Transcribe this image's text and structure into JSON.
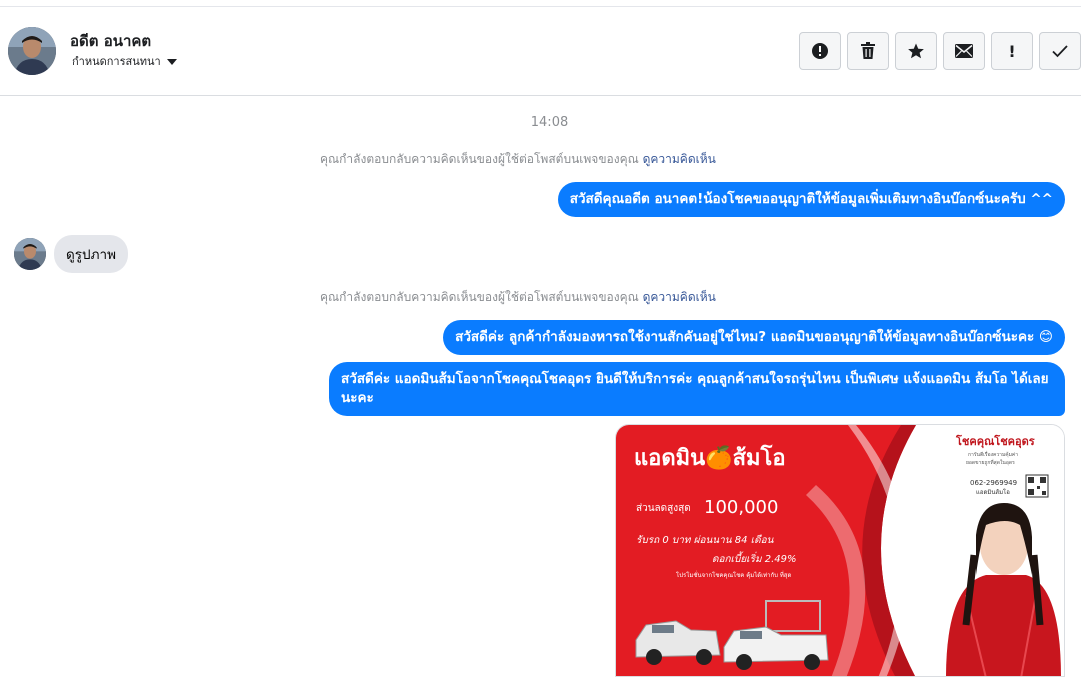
{
  "header": {
    "name": "อดีต อนาคต",
    "subtitle": "กำหนดการสนทนา",
    "actions": [
      {
        "icon": "alert-circle-icon",
        "glyph": "!"
      },
      {
        "icon": "trash-icon",
        "glyph": ""
      },
      {
        "icon": "star-icon",
        "glyph": "★"
      },
      {
        "icon": "envelope-icon",
        "glyph": "✉"
      },
      {
        "icon": "exclamation-icon",
        "glyph": "!"
      },
      {
        "icon": "checkmark-icon",
        "glyph": "✓"
      }
    ]
  },
  "conversation": {
    "timestamp": "14:08",
    "notes": [
      {
        "text": "คุณกำลังตอบกลับความคิดเห็นของผู้ใช้ต่อโพสต์บนเพจของคุณ",
        "link": "ดูความคิดเห็น"
      },
      {
        "text": "คุณกำลังตอบกลับความคิดเห็นของผู้ใช้ต่อโพสต์บนเพจของคุณ",
        "link": "ดูความคิดเห็น"
      }
    ],
    "messages": {
      "out1": "สวัสดีคุณอดีต อนาคต!น้องโชคขออนุญาติให้ข้อมูลเพิ่มเติมทางอินบ๊อกซ์นะครับ ^^",
      "in1": "ดูรูปภาพ",
      "out2": "สวัสดีค่ะ ลูกค้ากำลังมองหารถใช้งานสักคันอยู่ใช่ไหม? แอดมินขออนุญาติให้ข้อมูลทางอินบ๊อกซ์นะคะ 😊",
      "out3": "สวัสดีค่ะ แอดมินส้มโอจากโชคคุณโชคอุดร ยินดีให้บริการค่ะ  คุณลูกค้าสนใจรถรุ่นไหน เป็นพิเศษ แจ้งแอดมิน ส้มโอ ได้เลยนะคะ"
    },
    "promo_image": {
      "headline": "แอดมิน🍊ส้มโอ",
      "brand": "โชคคุณโชคอุดร",
      "brand_sub": "การันตีเรื่องความคุ้มค่า",
      "brand_sub2": "ยอดขายถูกที่สุดในอุดร",
      "phone": "062-2969949",
      "phone_label": "แอดมินส้มโอ",
      "discount_label": "ส่วนลดสูงสุด",
      "discount_value": "100,000",
      "line1": "รับรถ 0 บาท ผ่อนนาน 84 เดือน",
      "line2": "ดอกเบี้ยเริ่ม 2.49%",
      "line3": "โปรโมชั่นจากโชคคุณโชค คุ้มได้เท่ากับ ที่สุด"
    }
  },
  "colors": {
    "outgoing_bubble": "#0a7cff",
    "incoming_bubble": "#e4e6eb",
    "promo_red": "#e31c23"
  }
}
